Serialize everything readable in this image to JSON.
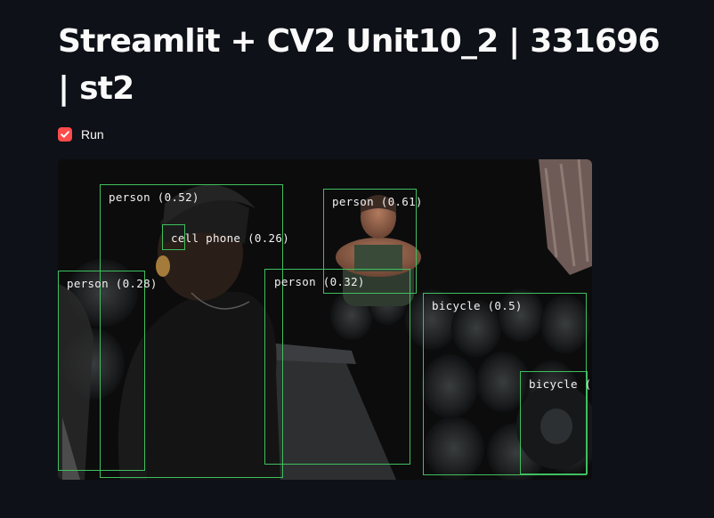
{
  "page": {
    "title": "Streamlit + CV2 Unit10_2 | 331696 | st2"
  },
  "run_checkbox": {
    "label": "Run",
    "checked": true,
    "accent_color": "#ff4b4b"
  },
  "video_frame": {
    "box_color": "#3fbf5f",
    "detections": [
      {
        "label": "person (0.52)"
      },
      {
        "label": "cell phone (0.26)"
      },
      {
        "label": "person (0.61)"
      },
      {
        "label": "person (0.28)"
      },
      {
        "label": "person (0.32)"
      },
      {
        "label": "bicycle (0.5)"
      },
      {
        "label": "bicycle ("
      }
    ]
  }
}
